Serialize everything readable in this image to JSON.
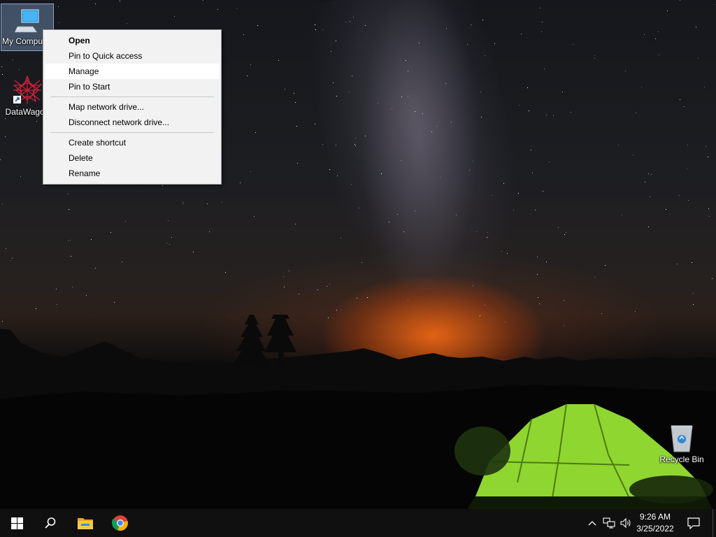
{
  "desktop": {
    "icons": [
      {
        "label": "My Computer",
        "icon": "computer-icon",
        "selected": true
      },
      {
        "label": "DataWagon",
        "icon": "datawagon-shortcut-icon",
        "selected": false
      },
      {
        "label": "Recycle Bin",
        "icon": "recycle-bin-icon",
        "selected": false
      }
    ]
  },
  "context_menu": {
    "items": [
      {
        "label": "Open",
        "bold": true
      },
      {
        "label": "Pin to Quick access"
      },
      {
        "label": "Manage",
        "hover": true
      },
      {
        "label": "Pin to Start"
      },
      {
        "label": "Map network drive..."
      },
      {
        "label": "Disconnect network drive..."
      },
      {
        "label": "Create shortcut"
      },
      {
        "label": "Delete"
      },
      {
        "label": "Rename"
      }
    ]
  },
  "taskbar": {
    "start": "windows-logo-icon",
    "search": "search-icon",
    "pinned": [
      "file-explorer-icon",
      "chrome-icon"
    ],
    "tray": {
      "time": "9:26 AM",
      "date": "3/25/2022",
      "icons": [
        "chevron-up-icon",
        "network-icon",
        "volume-icon",
        "notification-icon"
      ]
    }
  },
  "colors": {
    "menu_bg": "#f2f2f2",
    "menu_hover": "#ffffff",
    "taskbar_bg": "#101010",
    "tent_green": "#8fd630",
    "horizon_glow": "#ff6e14"
  }
}
